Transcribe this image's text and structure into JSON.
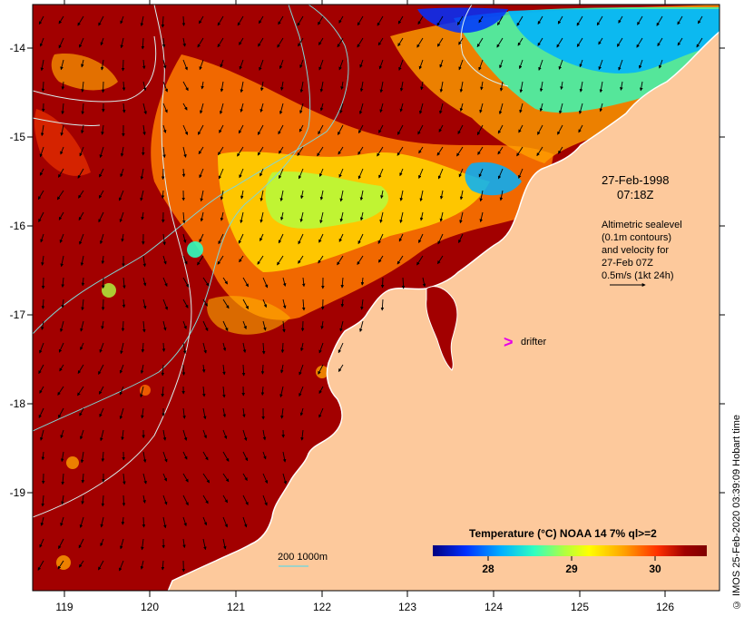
{
  "map": {
    "x_ticks": [
      "119",
      "120",
      "121",
      "122",
      "123",
      "124",
      "125",
      "126"
    ],
    "y_ticks": [
      "-14",
      "-15",
      "-16",
      "-17",
      "-18",
      "-19"
    ],
    "x_range": [
      118.65,
      126.65
    ],
    "y_range": [
      -20.05,
      -13.55
    ]
  },
  "annotation": {
    "date": "27-Feb-1998",
    "time": "07:18Z",
    "info_lines": [
      "Altimetric sealevel",
      "(0.1m contours)",
      "and velocity for",
      "27-Feb 07Z",
      "0.5m/s (1kt 24h)"
    ],
    "drifter_symbol": ">",
    "drifter_label": "drifter"
  },
  "colorbar": {
    "title": "Temperature (°C) NOAA 14 7% ql>=2",
    "ticks": [
      "28",
      "29",
      "30"
    ],
    "colors": [
      "#00007f",
      "#0030ff",
      "#00b0ff",
      "#30ffc0",
      "#b0ff40",
      "#ffff00",
      "#ffa000",
      "#ff3000",
      "#a00000",
      "#7f0000"
    ]
  },
  "bathymetry_legend": {
    "label": "200 1000m"
  },
  "credit": "© IMOS 25-Feb-2020 03:39:09 Hobart time",
  "colors": {
    "land": "#fdc99c",
    "warm_water": "#a20000",
    "contour": "#7fd6d6",
    "drifter": "#e600e6"
  }
}
